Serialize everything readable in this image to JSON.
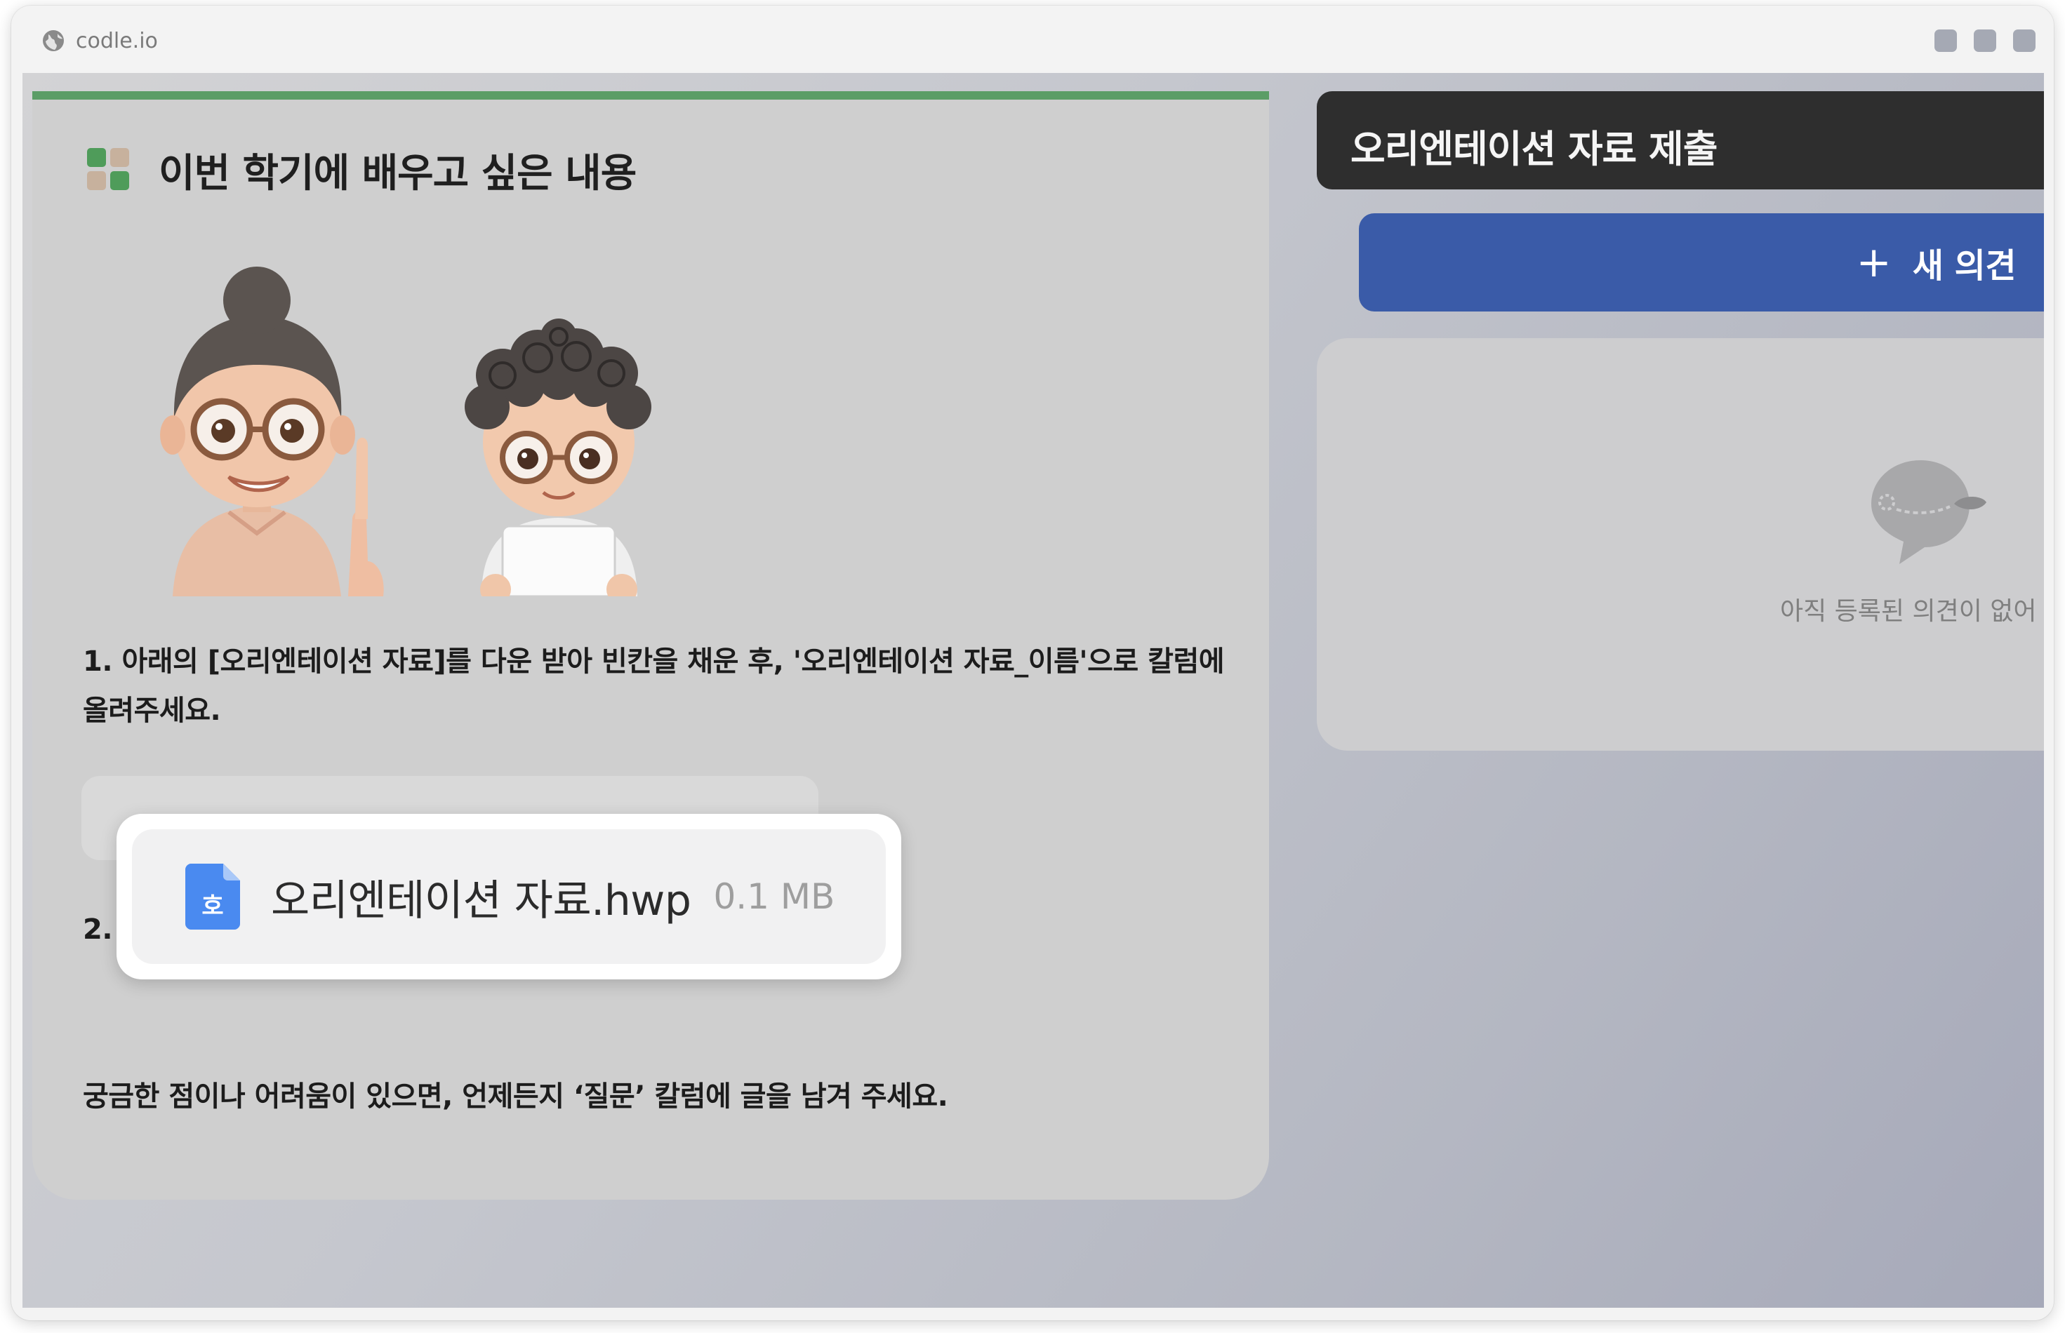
{
  "browser": {
    "url": "codle.io"
  },
  "activity_card": {
    "title": "이번 학기에 배우고 싶은 내용",
    "instruction_1": "1. 아래의 [오리엔테이션 자료]를 다운 받아 빈칸을 채운 후, '오리엔테이션 자료_이름'으로 칼럼에 올려주세요.",
    "attachment": {
      "file_name": "오리엔테이션 자료.hwp",
      "file_size": "0.1 MB",
      "file_icon_glyph": "호",
      "icon_color": "#4a8af0"
    },
    "instruction_2": "2.  이번 학기에 배우고 싶은 내용을 자유롭게 작성해 봅시다.",
    "note": "궁금한 점이나 어려움이 있으면, 언제든지 ‘질문’ 칼럼에 글을 남겨 주세요.",
    "accent_color": "#5b9d66"
  },
  "column": {
    "title": "오리엔테이션 자료 제출",
    "new_button_label": "새 의견",
    "new_button_icon": "plus-icon",
    "new_button_color": "#3a5ba8",
    "empty_state": "아직 등록된 의견이 없어"
  }
}
